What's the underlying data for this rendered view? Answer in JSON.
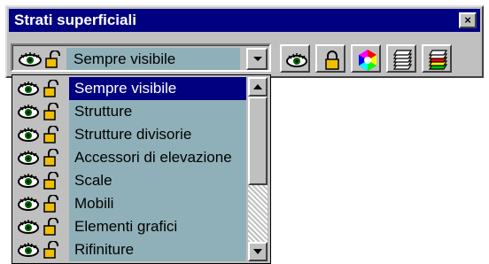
{
  "window": {
    "title": "Strati superficiali",
    "close_label": "×"
  },
  "combo": {
    "value": "Sempre visibile",
    "icons": [
      "eye-icon",
      "unlock-icon"
    ]
  },
  "toolbar": {
    "buttons": [
      {
        "name": "show-all-button",
        "icon": "eye-icon"
      },
      {
        "name": "lock-button",
        "icon": "lock-icon"
      },
      {
        "name": "color-button",
        "icon": "color-wheel-icon"
      },
      {
        "name": "layers-button",
        "icon": "layers-icon"
      },
      {
        "name": "layers-color-button",
        "icon": "layers-color-icon"
      }
    ]
  },
  "dropdown": {
    "items": [
      {
        "label": "Sempre visibile",
        "selected": true
      },
      {
        "label": "Strutture",
        "selected": false
      },
      {
        "label": "Strutture divisorie",
        "selected": false
      },
      {
        "label": "Accessori di elevazione",
        "selected": false
      },
      {
        "label": "Scale",
        "selected": false
      },
      {
        "label": "Mobili",
        "selected": false
      },
      {
        "label": "Elementi grafici",
        "selected": false
      },
      {
        "label": "Rifiniture",
        "selected": false
      }
    ]
  },
  "colors": {
    "title_bar": "#000080",
    "item_background": "#8fb0b8",
    "selection": "#000080",
    "face": "#c0c0c0"
  }
}
